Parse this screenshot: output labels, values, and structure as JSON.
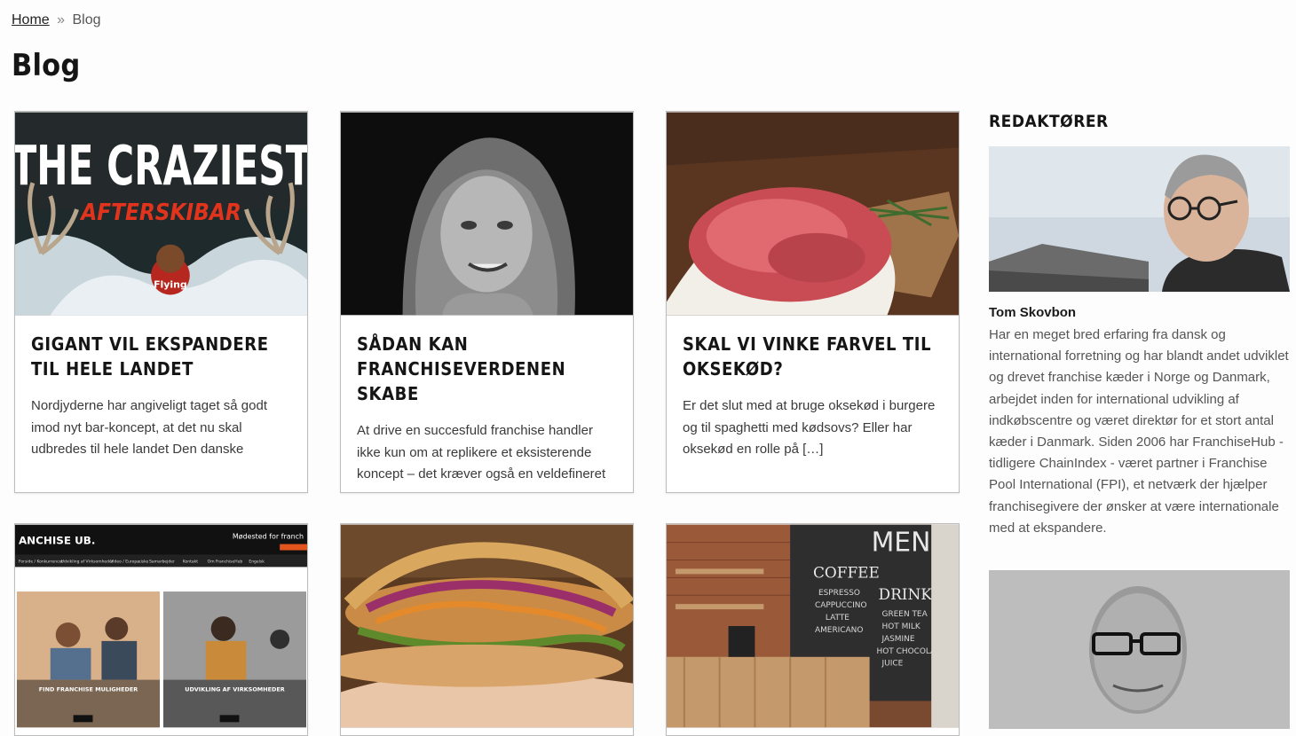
{
  "breadcrumb": {
    "home": "Home",
    "separator": "»",
    "current": "Blog"
  },
  "page": {
    "title": "Blog"
  },
  "posts": [
    {
      "title": "Gigant vil ekspandere til hele landet",
      "excerpt": "Nordjyderne har angiveligt taget så godt imod nyt bar-koncept, at det nu skal udbredes til hele landet Den danske",
      "image_text_main": "THE CRAZIEST",
      "image_text_sub": "AFTERSKIBAR",
      "image_text_logo": "Flying"
    },
    {
      "title": "Sådan kan franchiseverdenen skabe",
      "excerpt": "At drive en succesfuld franchise handler ikke kun om at replikere et eksisterende koncept – det kræver også en veldefineret"
    },
    {
      "title": "Skal vi vinke farvel til oksekød?",
      "excerpt": "Er det slut med at bruge oksekød i burgere og til spaghetti med kødsovs? Eller har oksekød en rolle på […]"
    },
    {
      "image_text_brand": "ANCHISE UB.",
      "image_text_tagline": "Mødested for franch",
      "image_nav": [
        "Forside / Konkurrencer",
        "Udvikling af Virksomheder",
        "Video / Europæiske",
        "Samarbejder",
        "Kontakt",
        "Om FranchiseHub",
        "Engelsk"
      ],
      "image_panel_left": "FIND FRANCHISE MULIGHEDER",
      "image_panel_right": "UDVIKLING AF VIRKSOMHEDER"
    },
    {},
    {
      "image_text_menu": "MENU",
      "image_text_coffee": "COFFEE",
      "image_text_drink": "DRINK",
      "image_menu_items": [
        "ESPRESSO",
        "CAPPUCCINO",
        "LATTE",
        "AMERICANO"
      ],
      "image_drink_items": [
        "GREEN TEA",
        "HOT MILK",
        "JASMINE",
        "HOT CHOCOLATE",
        "JUICE"
      ]
    }
  ],
  "sidebar": {
    "title": "REDAKTØRER",
    "editors": [
      {
        "name": "Tom Skovbon",
        "bio": "Har en meget bred erfaring fra dansk og international forretning og har blandt andet udviklet og drevet franchise kæder i Norge og Danmark, arbejdet inden for international udvikling af indkøbscentre og været direktør for et stort antal kæder i Danmark. Siden 2006 har FranchiseHub - tidligere ChainIndex - været partner i Franchise Pool International (FPI), et netværk der hjælper franchisegivere der ønsker at være internationale med at ekspandere."
      },
      {
        "name": "",
        "bio": ""
      }
    ]
  },
  "colors": {
    "accent_red": "#e2341d",
    "card_border": "#bdbdbd",
    "text_dark": "#151515",
    "text_body": "#3a3a3a"
  }
}
